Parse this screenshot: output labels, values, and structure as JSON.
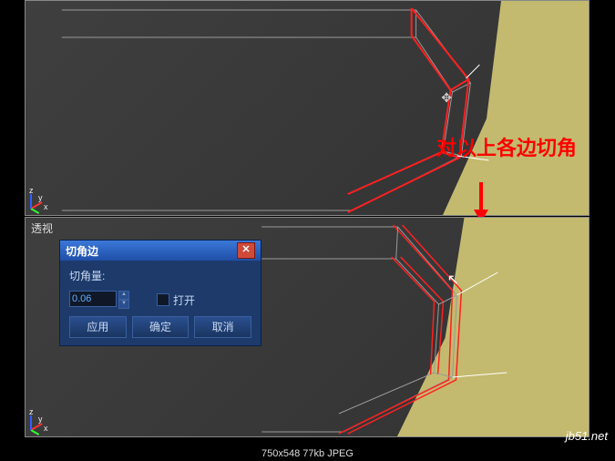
{
  "viewport_label": "透视",
  "annotation": "对以上各边切角",
  "dialog": {
    "title": "切角边",
    "amount_label": "切角量:",
    "amount_value": "0.06",
    "open_label": "打开",
    "apply": "应用",
    "ok": "确定",
    "cancel": "取消"
  },
  "footer": "750x548  77kb  JPEG",
  "watermark": "jb51.net",
  "gizmo": {
    "x": "x",
    "y": "y",
    "z": "z"
  }
}
